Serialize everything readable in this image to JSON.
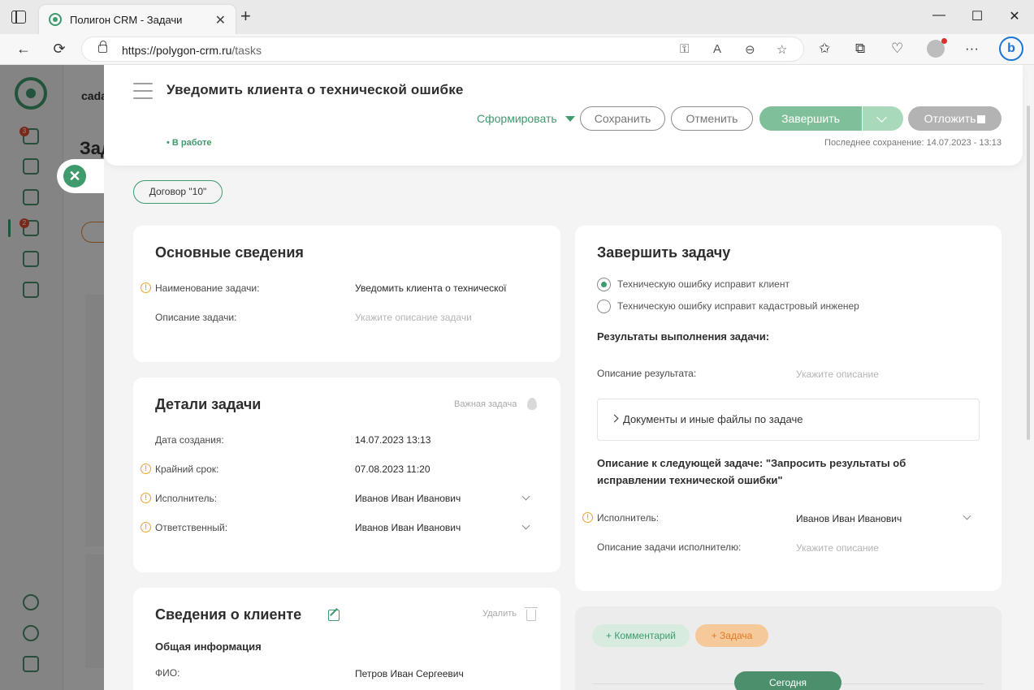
{
  "browser": {
    "tab_title": "Полигон CRM - Задачи",
    "tab_close": "✕",
    "new_tab": "+",
    "url_host": "https://polygon-crm.ru",
    "url_path": "/tasks",
    "bing_label": "b",
    "window_controls": {
      "minimize": "—",
      "maximize": "☐",
      "close": "✕"
    },
    "nav_icons": {
      "back": "←",
      "reload": "⟳"
    },
    "url_tools": {
      "key": "⚿",
      "read_aloud": "A",
      "zoom": "⊖",
      "favorite": "☆"
    },
    "toolbar_icons": {
      "favorites": "✩",
      "collections": "⧉",
      "health": "♡",
      "more": "···"
    }
  },
  "background": {
    "partial_text_1": "cada",
    "partial_text_2": "Зад",
    "badge_docs": "3",
    "badge_tasks": "2"
  },
  "drawer": {
    "close_icon": "✕",
    "title": "Уведомить клиента о технической ошибке",
    "form_label": "Сформировать",
    "save_label": "Сохранить",
    "cancel_label": "Отменить",
    "finish_label": "Завершить",
    "postpone_label": "Отложить",
    "status": "• В работе",
    "last_saved": "Последнее сохранение: 14.07.2023 - 13:13",
    "contract_label": "Договор \"10\""
  },
  "basic_info": {
    "title": "Основные сведения",
    "name_label": "Наименование задачи:",
    "name_value": "Уведомить клиента о техническої",
    "desc_label": "Описание задачи:",
    "desc_placeholder": "Укажите описание задачи"
  },
  "details": {
    "title": "Детали задачи",
    "important_label": "Важная задача",
    "created_label": "Дата создания:",
    "created_value": "14.07.2023 13:13",
    "deadline_label": "Крайний срок:",
    "deadline_value": "07.08.2023 11:20",
    "assignee_label": "Исполнитель:",
    "assignee_value": "Иванов Иван Иванович",
    "responsible_label": "Ответственный:",
    "responsible_value": "Иванов Иван Иванович"
  },
  "client": {
    "title": "Сведения о клиенте",
    "delete_label": "Удалить",
    "general_info": "Общая информация",
    "fio_label": "ФИО:",
    "fio_value": "Петров Иван Сергеевич"
  },
  "finish_task": {
    "title": "Завершить задачу",
    "option_1": "Техническую ошибку исправит клиент",
    "option_2": "Техническую ошибку исправит кадастровый инженер",
    "selected_option": 1,
    "results_title": "Результаты выполнения задачи:",
    "result_desc_label": "Описание результата:",
    "result_desc_placeholder": "Укажите описание",
    "documents_label": "Документы и иные файлы по задаче",
    "next_task_title": "Описание к следующей задаче: \"Запросить результаты об исправлении технической ошибки\"",
    "assignee_label": "Исполнитель:",
    "assignee_value": "Иванов Иван Иванович",
    "assignee_desc_label": "Описание задачи исполнителю:",
    "assignee_desc_placeholder": "Укажите описание"
  },
  "activity": {
    "comment_label": "+ Комментарий",
    "task_label": "+ Задача",
    "today_label": "Сегодня"
  },
  "colors": {
    "accent": "#3f9a6d",
    "finish_button": "#7fc09a",
    "task_pill": "#f6c99b",
    "warning": "#e8a628"
  }
}
